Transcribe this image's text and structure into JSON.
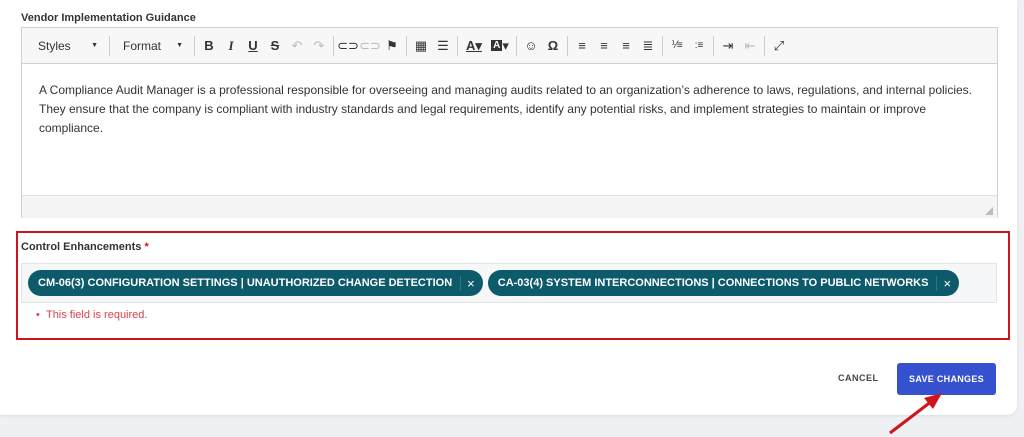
{
  "vendor_guidance": {
    "label": "Vendor Implementation Guidance",
    "toolbar": {
      "styles": "Styles",
      "format": "Format"
    },
    "content": "A Compliance Audit Manager is a professional responsible for overseeing and managing audits related to an organization’s adherence to laws, regulations, and internal policies. They ensure that the company is compliant with industry standards and legal requirements, identify any potential risks, and implement strategies to maintain or improve compliance."
  },
  "control_enhancements": {
    "label": "Control Enhancements",
    "required_mark": "*",
    "tags": [
      {
        "label": "CM-06(3) CONFIGURATION SETTINGS | UNAUTHORIZED CHANGE DETECTION"
      },
      {
        "label": "CA-03(4) SYSTEM INTERCONNECTIONS | CONNECTIONS TO PUBLIC NETWORKS"
      }
    ],
    "error": "This field is required."
  },
  "actions": {
    "cancel": "CANCEL",
    "save": "SAVE CHANGES"
  },
  "colors": {
    "tag": "#0d5a6b",
    "save": "#3551d0",
    "highlight": "#d0141b"
  }
}
